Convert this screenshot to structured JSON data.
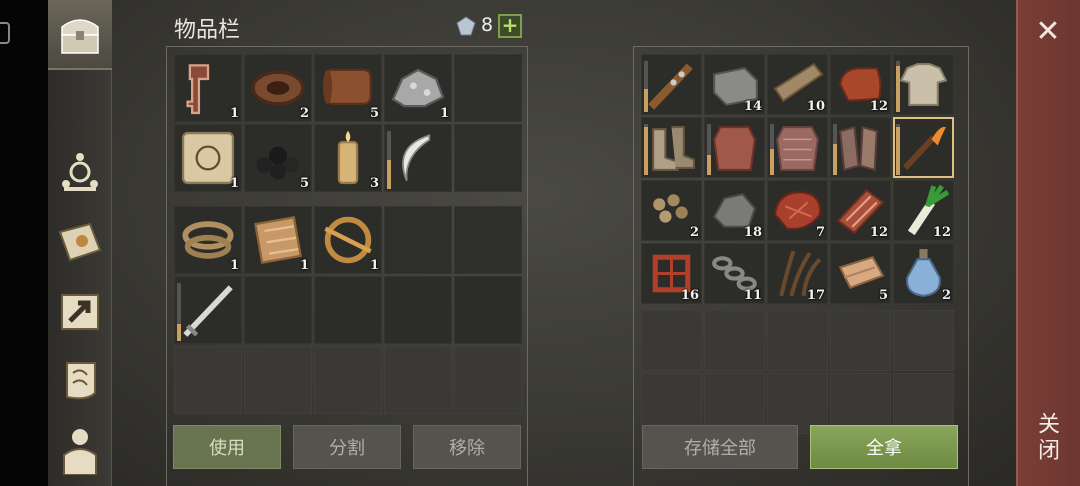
{
  "inventory": {
    "title": "物品栏",
    "gem_count": "8",
    "add_label": "+",
    "bag_items": [
      {
        "icon": "key-icon",
        "count": "1"
      },
      {
        "icon": "leather-roll-icon",
        "count": "2"
      },
      {
        "icon": "hide-scroll-icon",
        "count": "5"
      },
      {
        "icon": "ore-icon",
        "count": "1"
      },
      {
        "icon": "",
        "count": ""
      },
      {
        "icon": "map-scroll-icon",
        "count": "1"
      },
      {
        "icon": "coal-icon",
        "count": "5"
      },
      {
        "icon": "candle-icon",
        "count": "3"
      },
      {
        "icon": "sickle-icon",
        "count": ""
      },
      {
        "icon": "",
        "count": ""
      }
    ],
    "pocket_items": [
      {
        "icon": "rope-icon",
        "count": "1"
      },
      {
        "icon": "cloth-icon",
        "count": "1"
      },
      {
        "icon": "brooch-icon",
        "count": "1"
      },
      {
        "icon": "",
        "count": ""
      },
      {
        "icon": "",
        "count": ""
      },
      {
        "icon": "sword-icon",
        "count": ""
      }
    ],
    "buttons": {
      "use": "使用",
      "split": "分割",
      "remove": "移除"
    }
  },
  "storage": {
    "items": [
      {
        "icon": "spiked-club-icon",
        "count": ""
      },
      {
        "icon": "stone-block-icon",
        "count": "14"
      },
      {
        "icon": "wood-plank-icon",
        "count": "10"
      },
      {
        "icon": "copper-ingot-icon",
        "count": "12"
      },
      {
        "icon": "shirt-icon",
        "count": ""
      },
      {
        "icon": "boots-icon",
        "count": ""
      },
      {
        "icon": "leather-armor-icon",
        "count": ""
      },
      {
        "icon": "chainmail-icon",
        "count": ""
      },
      {
        "icon": "gauntlets-icon",
        "count": ""
      },
      {
        "icon": "torch-icon",
        "count": ""
      },
      {
        "icon": "nuts-icon",
        "count": "2"
      },
      {
        "icon": "stone-icon",
        "count": "18"
      },
      {
        "icon": "steak-icon",
        "count": "7"
      },
      {
        "icon": "bacon-icon",
        "count": "12"
      },
      {
        "icon": "leek-icon",
        "count": "12"
      },
      {
        "icon": "thread-icon",
        "count": "16"
      },
      {
        "icon": "chain-icon",
        "count": "11"
      },
      {
        "icon": "fiber-icon",
        "count": "17"
      },
      {
        "icon": "fabric-icon",
        "count": "5"
      },
      {
        "icon": "potion-icon",
        "count": "2"
      }
    ],
    "buttons": {
      "store_all": "存储全部",
      "take_all": "全拿"
    }
  },
  "close_label": "关闭",
  "side_tabs": [
    "chest-icon",
    "crafting-icon",
    "journal-icon",
    "build-icon",
    "quest-scroll-icon",
    "character-icon"
  ],
  "colors": {
    "accent_green": "#7fa04a",
    "close_bar": "#7a3f36",
    "durability": "#c8a060"
  }
}
